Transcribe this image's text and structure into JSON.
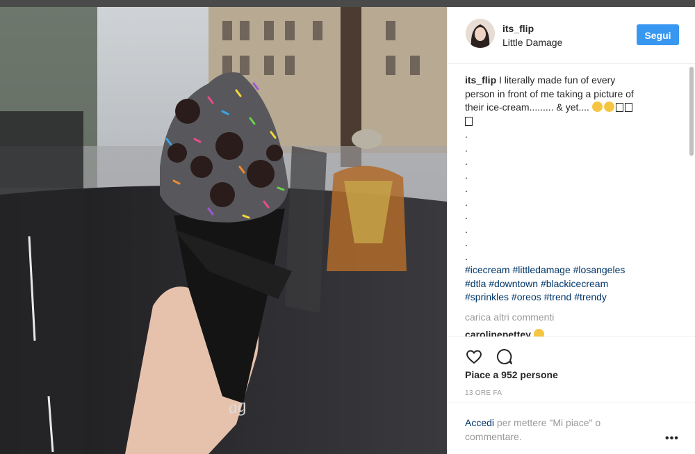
{
  "post": {
    "username": "its_flip",
    "location": "Little Damage",
    "follow_label": "Segui"
  },
  "caption": {
    "username": "its_flip",
    "text_line1": "I literally made fun of every",
    "text_line2": "person in front of me taking a picture of",
    "text_line3": "their ice-cream......... & yet....",
    "dots": [
      ".",
      ".",
      ".",
      ".",
      ".",
      ".",
      ".",
      ".",
      ".",
      "."
    ],
    "hashtags": [
      "#icecream #littledamage #losangeles",
      "#dtla #downtown #blackicecream",
      "#sprinkles #oreos #trend #trendy"
    ]
  },
  "load_more_label": "carica altri commenti",
  "comment2": {
    "username": "carolinepettey"
  },
  "likes": "Piace a 952 persone",
  "timestamp": "13 ORE FA",
  "login": {
    "link": "Accedi",
    "text": "per mettere \"Mi piace\" o commentare."
  },
  "more_options": "•••",
  "icons": [
    "heart-icon",
    "comment-icon",
    "more-options-icon"
  ],
  "colors": {
    "accent": "#3897f0",
    "link": "#003569",
    "muted": "#999999"
  }
}
